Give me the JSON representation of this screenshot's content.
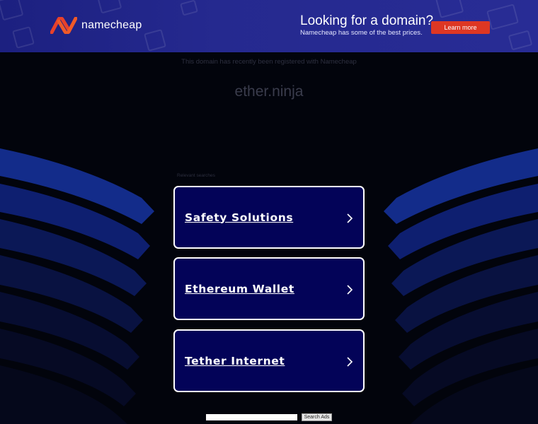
{
  "banner": {
    "logo_text": "namecheap",
    "promo_title": "Looking for a domain?",
    "promo_subtitle": "Namecheap has some of the best prices.",
    "cta_label": "Learn more",
    "accent_color": "#de3723"
  },
  "notice": "This domain has recently been registered with Namecheap",
  "domain_name": "ether.ninja",
  "related": {
    "label": "Relevant searches",
    "items": [
      {
        "label": "Safety Solutions",
        "icon": "chevron-right-icon"
      },
      {
        "label": "Ethereum Wallet",
        "icon": "chevron-right-icon"
      },
      {
        "label": "Tether Internet",
        "icon": "chevron-right-icon"
      }
    ]
  },
  "search": {
    "input_value": "",
    "button_label": "Search Ads"
  }
}
